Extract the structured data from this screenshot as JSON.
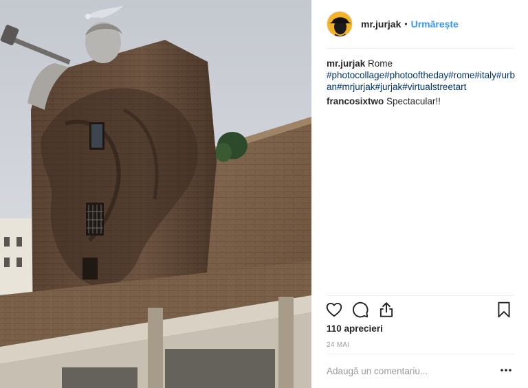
{
  "post": {
    "username": "mr.jurjak",
    "separator": "•",
    "follow_label": "Urmărește",
    "caption": {
      "username": "mr.jurjak",
      "text": "Rome",
      "hashtags": "#photocollage#photooftheday#rome#italy#urban#mrjurjak#jurjak#virtualstreetart"
    },
    "comments": [
      {
        "username": "francosixtwo",
        "text": "Spectacular!!"
      }
    ],
    "likes_label": "110 aprecieri",
    "date_label": "24 MAI",
    "comment_placeholder": "Adaugă un comentariu...",
    "icons": {
      "like": "heart-icon",
      "comment": "comment-icon",
      "share": "share-icon",
      "save": "bookmark-icon",
      "more": "more-options-icon"
    }
  },
  "colors": {
    "link_blue": "#3897f0",
    "hashtag_blue": "#003569",
    "text": "#262626",
    "muted": "#999999",
    "divider": "#efefef",
    "avatar_bg": "#f2b32a"
  }
}
